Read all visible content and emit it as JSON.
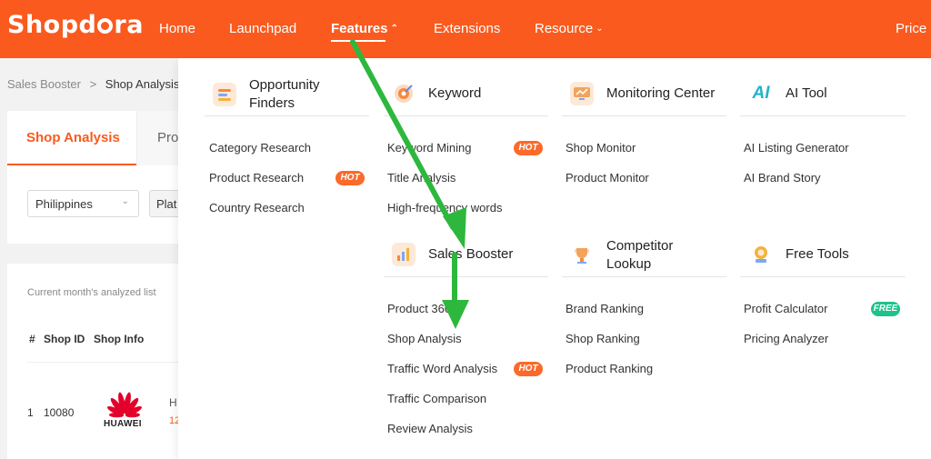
{
  "brand": {
    "name_left": "Shopd",
    "name_right": "ra"
  },
  "nav": {
    "home": "Home",
    "launchpad": "Launchpad",
    "features": "Features",
    "extensions": "Extensions",
    "resource": "Resource",
    "price": "Price"
  },
  "breadcrumb": {
    "parent": "Sales Booster",
    "separator": ">",
    "current": "Shop Analysis"
  },
  "page": {
    "tab_active": "Shop Analysis",
    "tab_other": "Pro",
    "country_select": "Philippines",
    "platform_select": "Plat",
    "analyzed_label": "Current month's analyzed list",
    "table_headers": [
      "#",
      "Shop ID",
      "Shop Info"
    ],
    "row": {
      "index": "1",
      "shop_id": "10080",
      "logo_text": "HUAWEI",
      "info_initial": "H",
      "info_number": "12"
    }
  },
  "menu": {
    "opportunity": {
      "title_line1": "Opportunity",
      "title_line2": "Finders",
      "items": [
        "Category Research",
        "Product Research",
        "Country Research"
      ]
    },
    "keyword": {
      "title": "Keyword",
      "items": [
        "Keyword Mining",
        "Title Analysis",
        "High-frequency words"
      ]
    },
    "monitoring": {
      "title": "Monitoring Center",
      "items": [
        "Shop Monitor",
        "Product Monitor"
      ]
    },
    "ai": {
      "title": "AI Tool",
      "icon_text": "AI",
      "items": [
        "AI Listing Generator",
        "AI Brand Story"
      ]
    },
    "sales": {
      "title": "Sales Booster",
      "items": [
        "Product 360",
        "Shop Analysis",
        "Traffic Word Analysis",
        "Traffic Comparison",
        "Review Analysis"
      ]
    },
    "competitor": {
      "title_line1": "Competitor",
      "title_line2": "Lookup",
      "items": [
        "Brand Ranking",
        "Shop Ranking",
        "Product Ranking"
      ]
    },
    "free": {
      "title": "Free Tools",
      "items": [
        "Profit Calculator",
        "Pricing Analyzer"
      ]
    },
    "badges": {
      "hot": "HOT",
      "free": "FREE"
    }
  },
  "colors": {
    "brand": "#fa5a1e",
    "annotation_arrow": "#2db83d",
    "hot": "#fa6a2a",
    "free": "#1ec28b"
  }
}
